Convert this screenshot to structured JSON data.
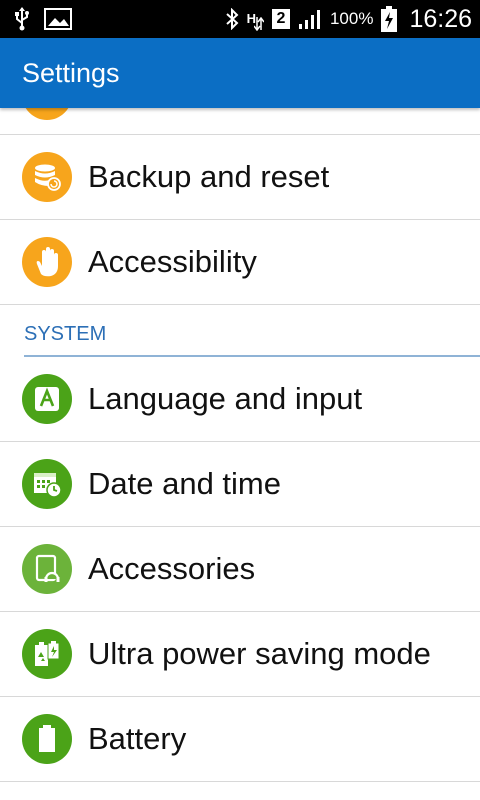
{
  "status_bar": {
    "battery_percent": "100%",
    "time": "16:26",
    "sim_slot": "2",
    "network_type": "H",
    "icons": [
      "usb-icon",
      "image-icon",
      "bluetooth-icon",
      "network-h-icon",
      "sim-icon",
      "signal-icon",
      "battery-charging-icon"
    ]
  },
  "app_bar": {
    "title": "Settings"
  },
  "list": {
    "items_top": [
      {
        "label": "Backup and reset",
        "icon": "backup-reset-icon",
        "color": "#f7a51c"
      },
      {
        "label": "Accessibility",
        "icon": "hand-icon",
        "color": "#f7a51c"
      }
    ],
    "section_header": "SYSTEM",
    "items_system": [
      {
        "label": "Language and input",
        "icon": "language-icon",
        "color": "#4ba318"
      },
      {
        "label": "Date and time",
        "icon": "calendar-clock-icon",
        "color": "#4ba318"
      },
      {
        "label": "Accessories",
        "icon": "accessories-icon",
        "color": "#6cb33a"
      },
      {
        "label": "Ultra power saving mode",
        "icon": "power-saving-icon",
        "color": "#4ba318"
      },
      {
        "label": "Battery",
        "icon": "battery-icon",
        "color": "#4ba318"
      }
    ]
  },
  "colors": {
    "app_bar": "#0b6ec4",
    "section_header_text": "#2c6fb6",
    "orange_icon": "#f7a51c",
    "green_icon": "#4ba318"
  }
}
